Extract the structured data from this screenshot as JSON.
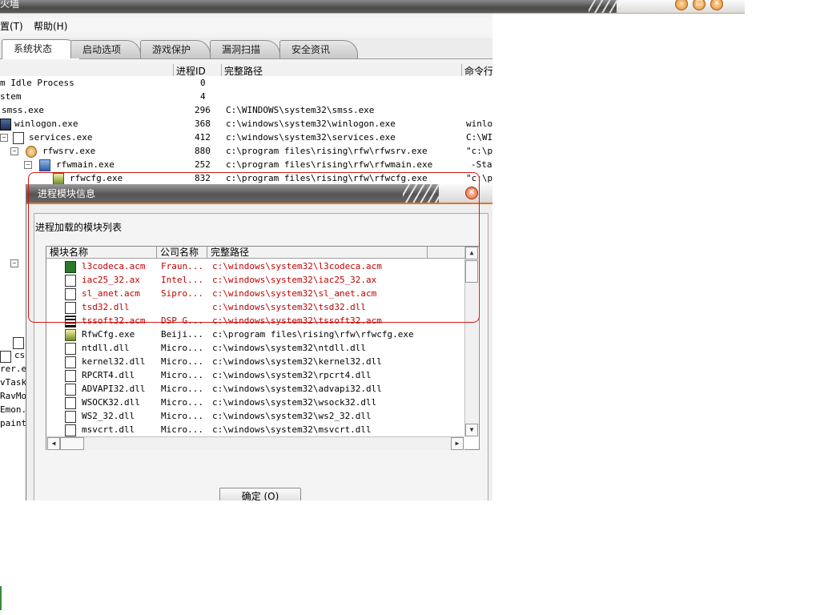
{
  "window": {
    "title": "火墙"
  },
  "menubar": {
    "items": [
      "置(T)",
      "帮助(H)"
    ]
  },
  "tabs": [
    "系统状态",
    "启动选项",
    "游戏保护",
    "漏洞扫描",
    "安全资讯"
  ],
  "process_table": {
    "headers": [
      "进程ID",
      "完整路径",
      "命令行"
    ],
    "rows": [
      {
        "name": "m Idle Process",
        "pid": "0",
        "path": "",
        "cmd": ""
      },
      {
        "name": "stem",
        "pid": "4",
        "path": "",
        "cmd": ""
      },
      {
        "name": "smss.exe",
        "pid": "296",
        "path": "C:\\WINDOWS\\system32\\smss.exe",
        "cmd": ""
      },
      {
        "name": "winlogon.exe",
        "pid": "368",
        "path": "c:\\windows\\system32\\winlogon.exe",
        "cmd": "winlo"
      },
      {
        "name": "services.exe",
        "pid": "412",
        "path": "c:\\windows\\system32\\services.exe",
        "cmd": "C:\\WIN"
      },
      {
        "name": "rfwsrv.exe",
        "pid": "880",
        "path": "c:\\program files\\rising\\rfw\\rfwsrv.exe",
        "cmd": "\"c:\\pr"
      },
      {
        "name": "rfwmain.exe",
        "pid": "252",
        "path": "c:\\program files\\rising\\rfw\\rfwmain.exe",
        "cmd": "-Star"
      },
      {
        "name": "rfwcfg.exe",
        "pid": "832",
        "path": "c:\\program files\\rising\\rfw\\rfwcfg.exe",
        "cmd": "\"c:\\pr"
      }
    ],
    "left_fragments": [
      "cs",
      "rer.ex",
      "vTask.",
      "RavMo",
      "Emon.e",
      "paint."
    ]
  },
  "dialog": {
    "title": "进程模块信息",
    "label": "进程加载的模块列表",
    "headers": [
      "模块名称",
      "公司名称",
      "完整路径"
    ],
    "rows": [
      {
        "name": "l3codeca.acm",
        "company": "Fraun...",
        "path": "c:\\windows\\system32\\l3codeca.acm",
        "red": true
      },
      {
        "name": "iac25_32.ax",
        "company": "Intel...",
        "path": "c:\\windows\\system32\\iac25_32.ax",
        "red": true
      },
      {
        "name": "sl_anet.acm",
        "company": "Sipro...",
        "path": "c:\\windows\\system32\\sl_anet.acm",
        "red": true
      },
      {
        "name": "tsd32.dll",
        "company": "",
        "path": "c:\\windows\\system32\\tsd32.dll",
        "red": true
      },
      {
        "name": "tssoft32.acm",
        "company": "DSP G...",
        "path": "c:\\windows\\system32\\tssoft32.acm",
        "red": true
      },
      {
        "name": "RfwCfg.exe",
        "company": "Beiji...",
        "path": "c:\\program files\\rising\\rfw\\rfwcfg.exe",
        "red": false
      },
      {
        "name": "ntdll.dll",
        "company": "Micro...",
        "path": "c:\\windows\\system32\\ntdll.dll",
        "red": false
      },
      {
        "name": "kernel32.dll",
        "company": "Micro...",
        "path": "c:\\windows\\system32\\kernel32.dll",
        "red": false
      },
      {
        "name": "RPCRT4.dll",
        "company": "Micro...",
        "path": "c:\\windows\\system32\\rpcrt4.dll",
        "red": false
      },
      {
        "name": "ADVAPI32.dll",
        "company": "Micro...",
        "path": "c:\\windows\\system32\\advapi32.dll",
        "red": false
      },
      {
        "name": "WSOCK32.dll",
        "company": "Micro...",
        "path": "c:\\windows\\system32\\wsock32.dll",
        "red": false
      },
      {
        "name": "WS2_32.dll",
        "company": "Micro...",
        "path": "c:\\windows\\system32\\ws2_32.dll",
        "red": false
      },
      {
        "name": "msvcrt.dll",
        "company": "Micro...",
        "path": "c:\\windows\\system32\\msvcrt.dll",
        "red": false
      }
    ],
    "ok_label": "确定 (O)"
  },
  "colors": {
    "highlight": "#d01818",
    "module_red": "#c00000",
    "accent": "#e07a20"
  }
}
